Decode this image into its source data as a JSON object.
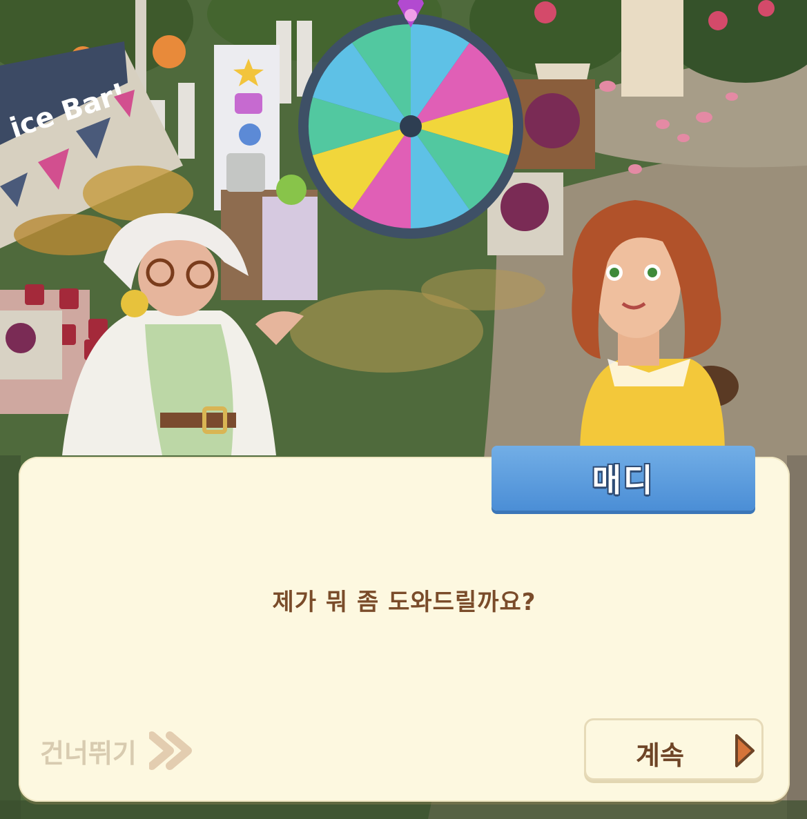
{
  "scene": {
    "stall_sign": "ice Bar!",
    "colors": {
      "grass": "#4f6a3c",
      "path": "#9b8f7a",
      "wheel_rim": "#3e5066",
      "dialog_bg": "#fdf8e0",
      "speaker_tab": "#5b9ddf",
      "text_brown": "#7a4c2a"
    }
  },
  "dialog": {
    "speaker": "매디",
    "message": "제가 뭐 좀 도와드릴까요?",
    "skip_label": "건너뛰기",
    "continue_label": "계속"
  }
}
